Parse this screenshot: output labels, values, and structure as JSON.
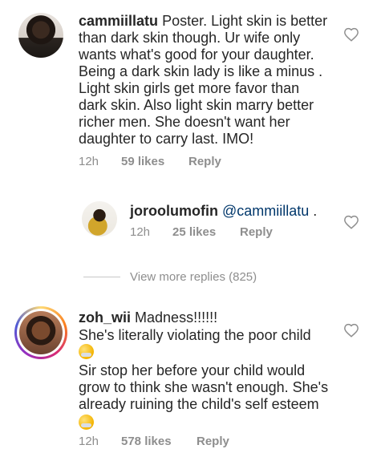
{
  "comments": [
    {
      "username": "cammiillatu",
      "lines": [
        "Poster.  Light skin is better",
        "than dark skin though. Ur wife only",
        "wants what's good for your daughter.",
        "Being a dark skin lady is like a minus .",
        "Light skin girls get more favor than",
        "dark skin. Also light skin marry better",
        "richer men. She doesn't want her",
        "daughter to carry last. IMO!"
      ],
      "time": "12h",
      "likes": "59 likes",
      "reply": "Reply"
    },
    {
      "username": "joroolumofin",
      "mention": "@cammiillatu",
      "text_after": " .",
      "time": "12h",
      "likes": "25 likes",
      "reply": "Reply"
    },
    {
      "username": "zoh_wii",
      "line1": "Madness!!!!!!",
      "line2": " She's literally violating the poor child",
      "line3": "Sir stop her before your child would",
      "line4": "grow to think she wasn't enough. She's",
      "line5": "already ruining the child's self esteem",
      "time": "12h",
      "likes": "578 likes",
      "reply": "Reply"
    }
  ],
  "view_more": "View more replies (825)",
  "icons": {
    "like": "heart-outline-icon",
    "emoji": "sleepy-face-emoji"
  }
}
